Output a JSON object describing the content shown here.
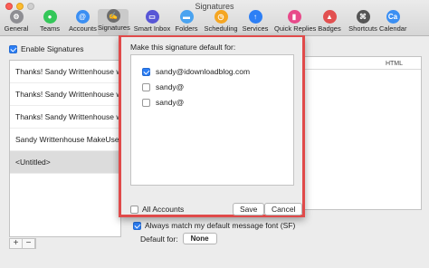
{
  "window": {
    "title": "Signatures"
  },
  "toolbar": {
    "items": [
      {
        "label": "General",
        "icon": "general-icon",
        "color": "#8e8e93",
        "glyph": "⚙"
      },
      {
        "label": "Teams",
        "icon": "teams-icon",
        "color": "#34c759",
        "glyph": "●"
      },
      {
        "label": "Accounts",
        "icon": "accounts-icon",
        "color": "#3b8ff3",
        "glyph": "@"
      },
      {
        "label": "Signatures",
        "icon": "signature-icon",
        "color": "#6d6d6d",
        "glyph": "✍"
      },
      {
        "label": "Smart Inbox",
        "icon": "smart-inbox-icon",
        "color": "#5856d6",
        "glyph": "▭"
      },
      {
        "label": "Folders",
        "icon": "folders-icon",
        "color": "#4aa3f0",
        "glyph": "▬"
      },
      {
        "label": "Scheduling",
        "icon": "scheduling-icon",
        "color": "#f5a623",
        "glyph": "◷"
      },
      {
        "label": "Services",
        "icon": "services-icon",
        "color": "#2d7ff5",
        "glyph": "↑"
      },
      {
        "label": "Quick Replies",
        "icon": "quick-replies-icon",
        "color": "#e84a8a",
        "glyph": "▮"
      },
      {
        "label": "Badges",
        "icon": "badges-icon",
        "color": "#e25050",
        "glyph": "▲"
      },
      {
        "label": "Shortcuts",
        "icon": "shortcuts-icon",
        "color": "#555555",
        "glyph": "⌘"
      },
      {
        "label": "Calendar",
        "icon": "calendar-icon",
        "color": "#3b8ff3",
        "glyph": "Ca"
      }
    ]
  },
  "left": {
    "enable_label": "Enable Signatures",
    "signatures": [
      "Thanks! Sandy Writtenhouse ww...",
      "Thanks! Sandy Writtenhouse ww...",
      "Thanks! Sandy Writtenhouse ww...",
      "Sandy Writtenhouse MakeUseOf...",
      "<Untitled>"
    ],
    "add_label": "+",
    "remove_label": "−"
  },
  "editor": {
    "html_label": "HTML",
    "match_label": "Always match my default message font (SF)",
    "default_for_label": "Default for:",
    "default_for_value": "None"
  },
  "sheet": {
    "title": "Make this signature default for:",
    "accounts": [
      {
        "label": "sandy@idownloadblog.com",
        "checked": true
      },
      {
        "label": "sandy@",
        "checked": false
      },
      {
        "label": "sandy@",
        "checked": false
      }
    ],
    "all_accounts_label": "All Accounts",
    "save_label": "Save",
    "cancel_label": "Cancel"
  }
}
